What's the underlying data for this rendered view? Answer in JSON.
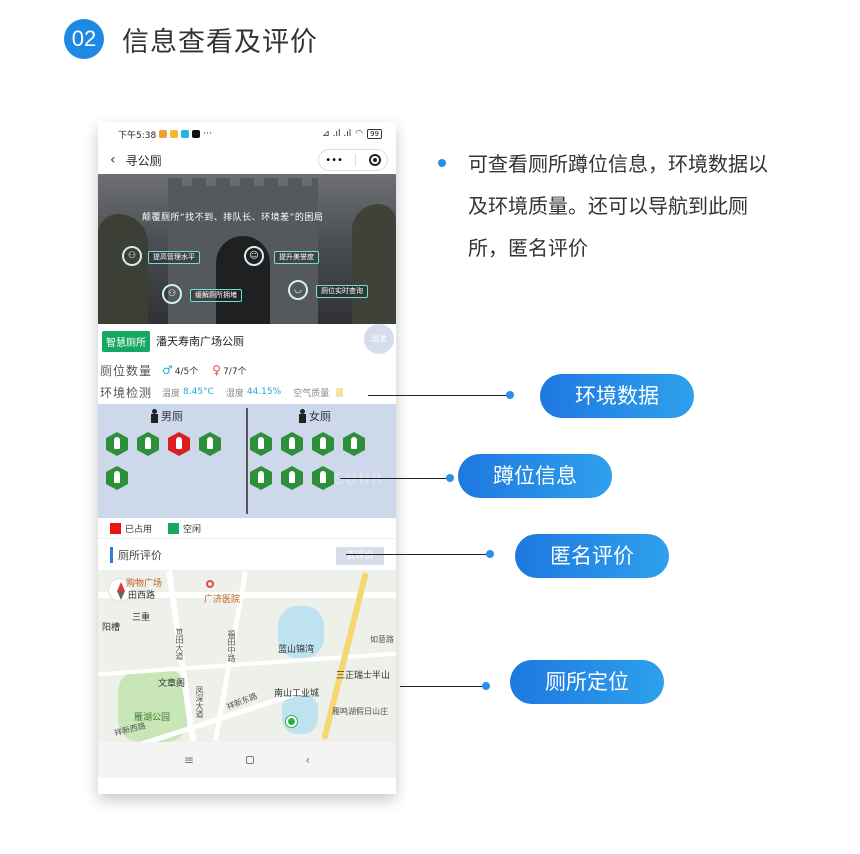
{
  "header": {
    "step": "02",
    "title": "信息查看及评价"
  },
  "phone": {
    "status": {
      "time": "下午5:38",
      "dots": "···",
      "signal": "⊿ .ıl .ıl",
      "battery": "99"
    },
    "nav": {
      "back": "‹",
      "title": "寻公厕",
      "menu": "•••"
    },
    "banner": {
      "title": "颠覆厕所“找不到、排队长、环境差”的困局",
      "pills": [
        "提高管理水平",
        "提升美誉度",
        "缓解厕所拥堵",
        "厕位实时查询"
      ]
    },
    "toilet": {
      "tag": "智慧厕所",
      "name": "潘天寿南广场公厕",
      "go": "出发"
    },
    "pits_row": {
      "label": "厕位数量",
      "male_count": "4/5个",
      "female_count": "7/7个"
    },
    "env": {
      "label": "环境检测",
      "temp_label": "温度",
      "temp_value": "8.45°C",
      "humidity_label": "湿度",
      "humidity_value": "44.15%",
      "air_label": "空气质量"
    },
    "pits": {
      "male_label": "男厕",
      "female_label": "女厕",
      "male": [
        "free",
        "free",
        "busy",
        "free",
        "free"
      ],
      "female": [
        "free",
        "free",
        "free",
        "free",
        "free",
        "free",
        "free"
      ],
      "watermark": "SUNR"
    },
    "legend": {
      "occupied": "已占用",
      "free": "空闲",
      "occupied_color": "#ee1111",
      "free_color": "#14a862"
    },
    "review": {
      "label": "厕所评价",
      "button": "去评价"
    },
    "map": {
      "labels": [
        "购物广场",
        "广济医院",
        "田西路",
        "三重",
        "阳槽",
        "笕田大道",
        "福田中路",
        "蓝山锦湾",
        "如意路",
        "三正瑞士半山",
        "文章阁",
        "南山工业城",
        "雁鸣湖假日山庄",
        "雁湖公园",
        "祥新东路",
        "祥新西路",
        "凤深大道"
      ]
    },
    "sysnav": {
      "menu": "≡",
      "back": "‹"
    }
  },
  "description": "可查看厕所蹲位信息，环境数据以及环境质量。还可以导航到此厕所，匿名评价",
  "callouts": [
    "环境数据",
    "蹲位信息",
    "匿名评价",
    "厕所定位"
  ],
  "colors": {
    "accent": "#1e88e5",
    "busy": "#d9201f",
    "free": "#2e8f3a"
  }
}
